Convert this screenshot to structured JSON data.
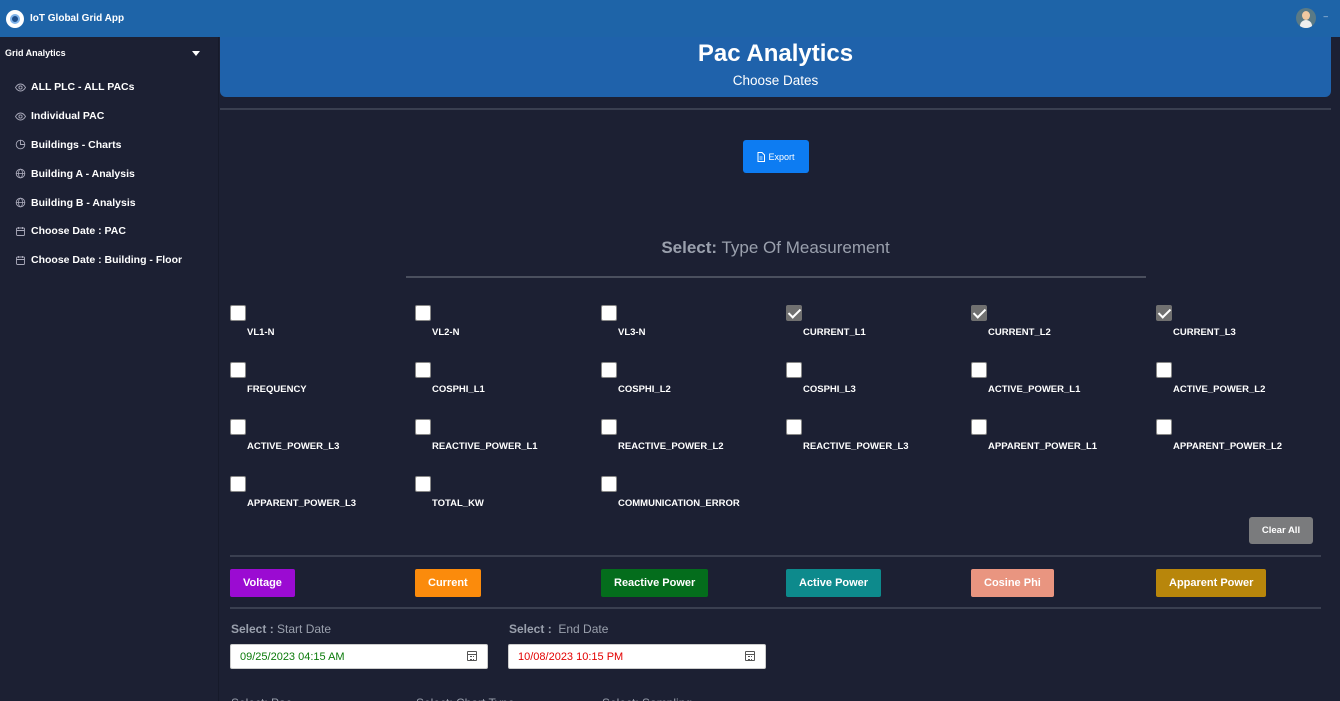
{
  "app": {
    "title": "IoT Global Grid App"
  },
  "sidebar": {
    "section": "Grid Analytics",
    "items": [
      {
        "label": "ALL PLC - ALL PACs",
        "icon": "eye-icon"
      },
      {
        "label": "Individual PAC",
        "icon": "eye-icon"
      },
      {
        "label": "Buildings - Charts",
        "icon": "pie-chart-icon"
      },
      {
        "label": "Building A - Analysis",
        "icon": "globe-icon"
      },
      {
        "label": "Building B - Analysis",
        "icon": "globe-icon"
      },
      {
        "label": "Choose Date : PAC",
        "icon": "calendar-icon"
      },
      {
        "label": "Choose Date : Building - Floor",
        "icon": "calendar-icon"
      }
    ]
  },
  "banner": {
    "title": "Pac Analytics",
    "subtitle": "Choose Dates"
  },
  "export": {
    "label": "Export"
  },
  "measurement": {
    "title_bold": "Select:",
    "title_rest": " Type Of Measurement",
    "options": [
      {
        "label": "VL1-N",
        "checked": false
      },
      {
        "label": "VL2-N",
        "checked": false
      },
      {
        "label": "VL3-N",
        "checked": false
      },
      {
        "label": "CURRENT_L1",
        "checked": true
      },
      {
        "label": "CURRENT_L2",
        "checked": true
      },
      {
        "label": "CURRENT_L3",
        "checked": true
      },
      {
        "label": "FREQUENCY",
        "checked": false
      },
      {
        "label": "COSPHI_L1",
        "checked": false
      },
      {
        "label": "COSPHI_L2",
        "checked": false
      },
      {
        "label": "COSPHI_L3",
        "checked": false
      },
      {
        "label": "ACTIVE_POWER_L1",
        "checked": false
      },
      {
        "label": "ACTIVE_POWER_L2",
        "checked": false
      },
      {
        "label": "ACTIVE_POWER_L3",
        "checked": false
      },
      {
        "label": "REACTIVE_POWER_L1",
        "checked": false
      },
      {
        "label": "REACTIVE_POWER_L2",
        "checked": false
      },
      {
        "label": "REACTIVE_POWER_L3",
        "checked": false
      },
      {
        "label": "APPARENT_POWER_L1",
        "checked": false
      },
      {
        "label": "APPARENT_POWER_L2",
        "checked": false
      },
      {
        "label": "APPARENT_POWER_L3",
        "checked": false
      },
      {
        "label": "TOTAL_KW",
        "checked": false
      },
      {
        "label": "COMMUNICATION_ERROR",
        "checked": false
      }
    ],
    "clear_label": "Clear All"
  },
  "categories": [
    {
      "label": "Voltage",
      "color": "#9b0bd2"
    },
    {
      "label": "Current",
      "color": "#fb8b0c"
    },
    {
      "label": "Reactive Power",
      "color": "#046d1c"
    },
    {
      "label": "Active Power",
      "color": "#0d8a8c"
    },
    {
      "label": "Cosine Phi",
      "color": "#e99580"
    },
    {
      "label": "Apparent Power",
      "color": "#b8860b"
    }
  ],
  "dates": {
    "start": {
      "label_bold": "Select :",
      "label_rest": " Start Date",
      "value": "09/25/2023 04:15 AM",
      "color": "#0a7a0a"
    },
    "end": {
      "label_bold": "Select :",
      "label_rest": "  End Date",
      "value": "10/08/2023 10:15 PM",
      "color": "#e30000"
    }
  },
  "bottom": {
    "labels": [
      "Select: Pac",
      "Select: Chart Type",
      "Select: Sampling"
    ]
  }
}
